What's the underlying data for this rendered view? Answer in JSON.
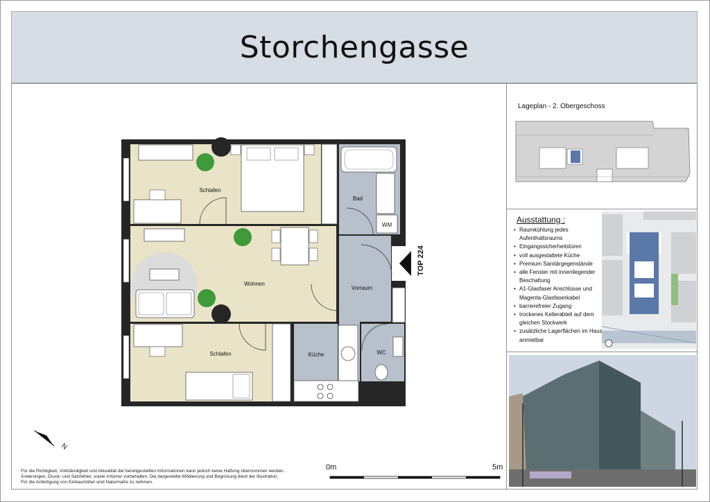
{
  "title": "Storchengasse",
  "rooms": {
    "schlafen_1": "Schlafen",
    "wohnen": "Wohnen",
    "schlafen_2": "Schlafen",
    "bad": "Bad",
    "wm": "WM",
    "vorraum": "Vorraum",
    "kueche": "Küche",
    "wc": "WC"
  },
  "unit_label": "TOP 224",
  "north_label": "N",
  "site_plan": {
    "title": "Lageplan - 2. Obergeschoss"
  },
  "features": {
    "title": "Ausstattung :",
    "items": [
      "Raumkühlung jedes Aufenthaltsraums",
      "Eingangssicherheitstüren",
      "voll ausgestattete Küche",
      "Premium Sanitärgegenstände",
      "alle Fenster mit innenliegender Beschattung",
      "A1-Glasfaser Anschlüsse und Magenta-Glasfaserkabel",
      "barrierefreier Zugang",
      "trockenes Kellerabteil auf dem gleichen Stockwerk",
      "zusätzliche Lagerflächen im Haus anmietbar"
    ]
  },
  "scale": {
    "start": "0m",
    "end": "5m"
  },
  "disclaimer": [
    "Für die Richtigkeit, Vollständigkeit und Aktualität der bereitgestellten Informationen kann jedoch keine Haftung übernommen werden.",
    "Änderungen, Druck- und Satzfehler, sowie Irrtümer vorbehalten. Die dargestellte Möblierung und Begrünung dient der Illustration.",
    "Für die Anfertigung von Einbaumöbel sind Naturmaße zu nehmen."
  ],
  "colors": {
    "title_bg": "#d7dde4",
    "living_floor": "#e9e3c8",
    "wet_floor": "#b7c0cb",
    "wall": "#262626",
    "highlight_unit": "#5a78a8",
    "plant": "#3f9a3a"
  }
}
